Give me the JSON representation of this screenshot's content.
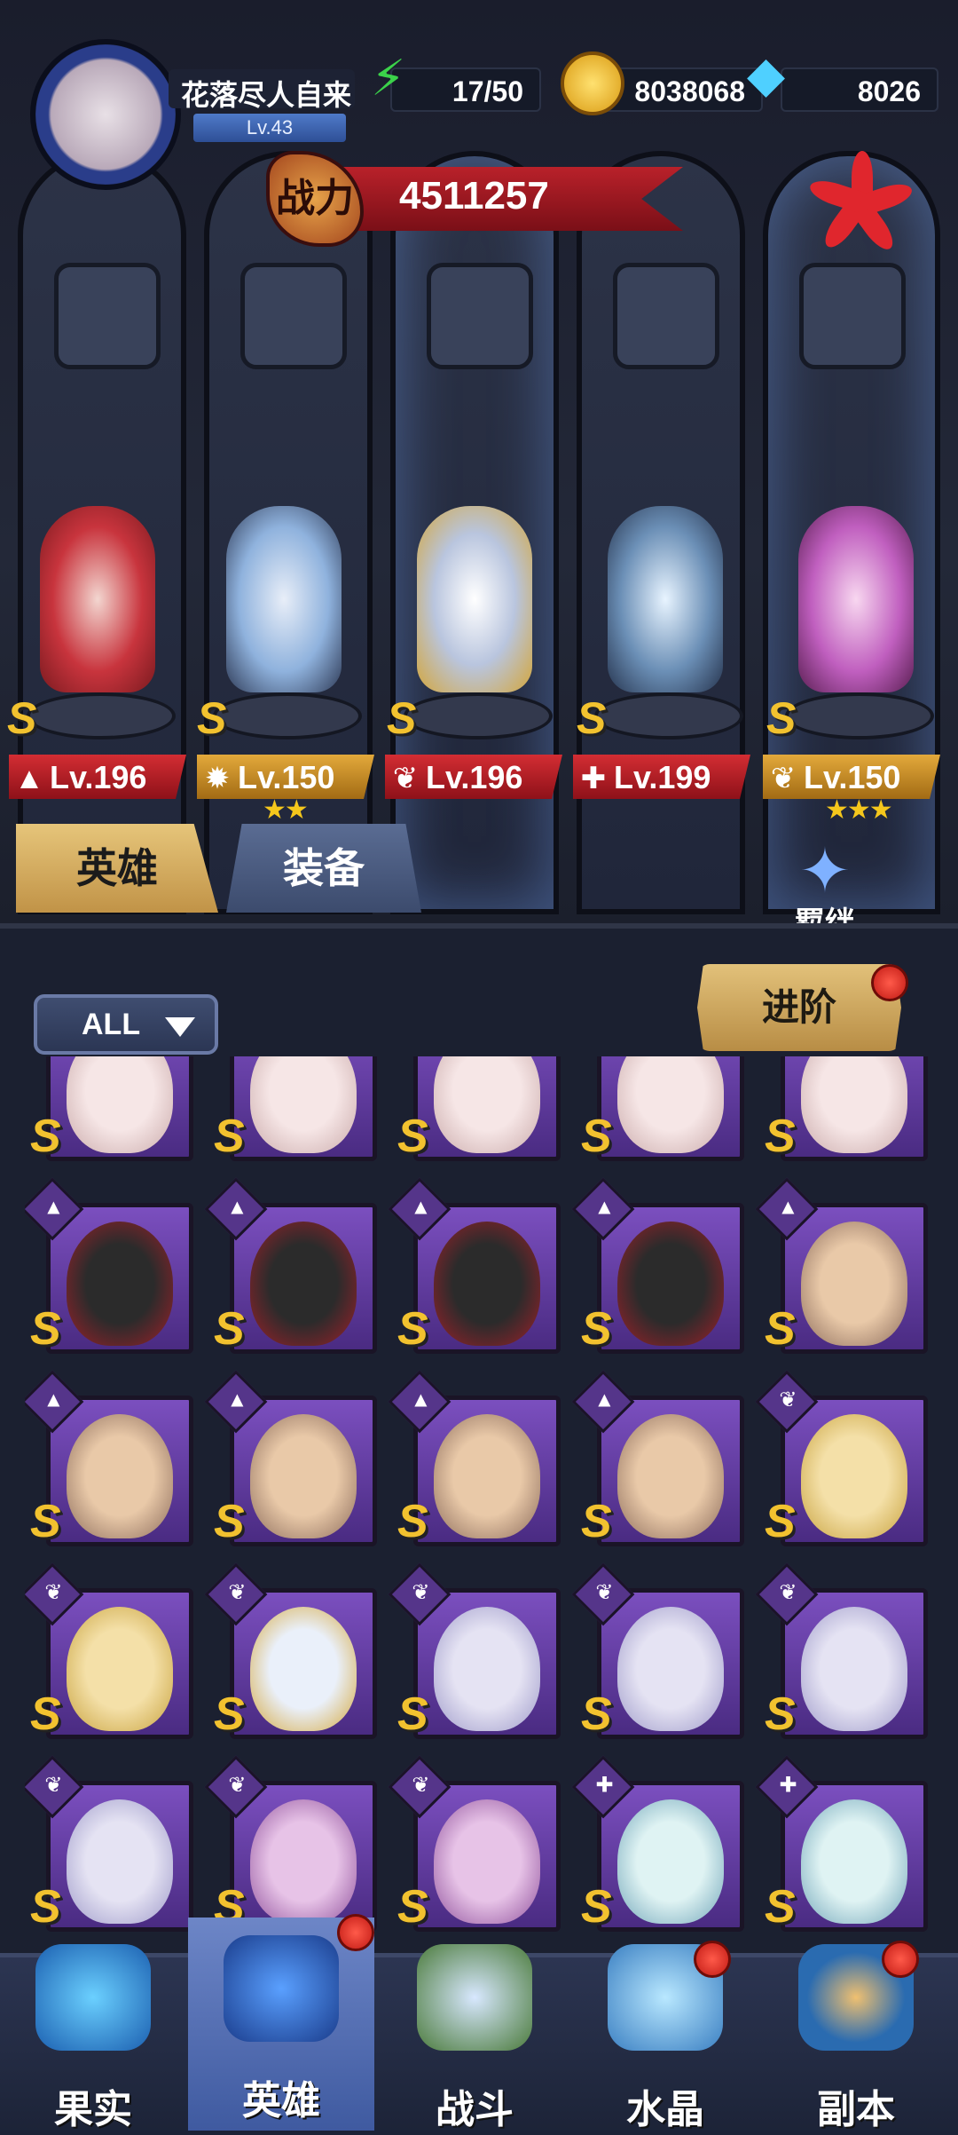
{
  "player": {
    "name": "花落尽人自来",
    "level": "Lv.43"
  },
  "resources": {
    "stamina": "17/50",
    "gold": "8038068",
    "diamond": "8026"
  },
  "power": {
    "label": "战力",
    "value": "4511257"
  },
  "lineup": [
    {
      "level": "Lv.196",
      "rank": "S",
      "stars": ""
    },
    {
      "level": "Lv.150",
      "rank": "S",
      "stars": "★★"
    },
    {
      "level": "Lv.196",
      "rank": "S",
      "stars": ""
    },
    {
      "level": "Lv.199",
      "rank": "S",
      "stars": ""
    },
    {
      "level": "Lv.150",
      "rank": "S",
      "stars": "★★★"
    }
  ],
  "tabs": {
    "heroes": "英雄",
    "equipment": "装备"
  },
  "bond_label": "羁绊",
  "filter": {
    "value": "ALL"
  },
  "advance_label": "进阶",
  "grid_rank": "S",
  "nav": [
    {
      "label": "果实"
    },
    {
      "label": "英雄"
    },
    {
      "label": "战斗"
    },
    {
      "label": "水晶"
    },
    {
      "label": "副本"
    }
  ],
  "colors": {
    "accent_gold": "#e2c17a",
    "level_red": "#d32d33",
    "card_purple": "#7b4fbf",
    "nav_active": "#6d86c7"
  }
}
